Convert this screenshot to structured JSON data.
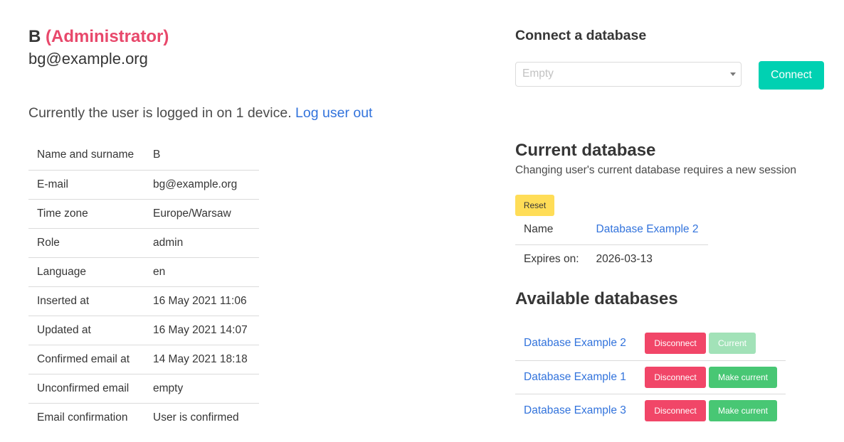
{
  "user": {
    "name": "B",
    "role_label": "(Administrator)",
    "email": "bg@example.org"
  },
  "sessions": {
    "text": "Currently the user is logged in on 1 device.",
    "logout_link": "Log user out"
  },
  "info_table": [
    {
      "label": "Name and surname",
      "value": "B"
    },
    {
      "label": "E-mail",
      "value": "bg@example.org"
    },
    {
      "label": "Time zone",
      "value": "Europe/Warsaw"
    },
    {
      "label": "Role",
      "value": "admin"
    },
    {
      "label": "Language",
      "value": "en"
    },
    {
      "label": "Inserted at",
      "value": "16 May 2021 11:06"
    },
    {
      "label": "Updated at",
      "value": "16 May 2021 14:07"
    },
    {
      "label": "Confirmed email at",
      "value": "14 May 2021 18:18"
    },
    {
      "label": "Unconfirmed email",
      "value": "empty"
    },
    {
      "label": "Email confirmation",
      "value": "User is confirmed"
    }
  ],
  "connect": {
    "title": "Connect a database",
    "select_placeholder": "Empty",
    "button_label": "Connect",
    "button_color": "#00d1b2"
  },
  "current_db": {
    "title": "Current database",
    "subtitle": "Changing user's current database requires a new session",
    "reset_label": "Reset",
    "name_label": "Name",
    "name_value": "Database Example 2",
    "expires_label": "Expires on:",
    "expires_value": "2026-03-13"
  },
  "available": {
    "title": "Available databases",
    "disconnect_label": "Disconnect",
    "make_current_label": "Make current",
    "current_label": "Current",
    "items": [
      {
        "name": "Database Example 2",
        "is_current": true
      },
      {
        "name": "Database Example 1",
        "is_current": false
      },
      {
        "name": "Database Example 3",
        "is_current": false
      }
    ]
  },
  "colors": {
    "role": "#e8486b",
    "link": "#3273dc",
    "danger": "#f14668",
    "success": "#48c774",
    "warning": "#ffdd57"
  }
}
